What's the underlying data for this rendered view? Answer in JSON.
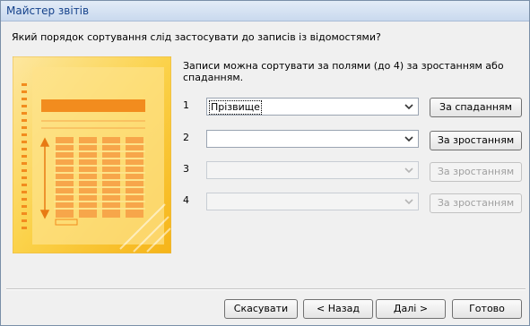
{
  "window": {
    "title": "Майстер звітів"
  },
  "question": "Який порядок сортування слід застосувати до записів із відомостями?",
  "hint": "Записи можна сортувати за полями (до 4) за зростанням або спаданням.",
  "sort_rows": [
    {
      "number": "1",
      "field": "Прізвище",
      "order_label": "За спаданням",
      "enabled": true
    },
    {
      "number": "2",
      "field": "",
      "order_label": "За зростанням",
      "enabled": true
    },
    {
      "number": "3",
      "field": "",
      "order_label": "За зростанням",
      "enabled": false
    },
    {
      "number": "4",
      "field": "",
      "order_label": "За зростанням",
      "enabled": false
    }
  ],
  "footer": {
    "cancel_label": "Скасувати",
    "back_label": "< Назад",
    "next_label": "Далі >",
    "finish_label": "Готово"
  },
  "icons": {
    "dropdown": "chevron-down-icon",
    "illustration": "report-sort-illustration"
  },
  "colors": {
    "title_text": "#15428b",
    "illustration_bg": "#fbd24a",
    "illustration_bar": "#f28c1e"
  }
}
